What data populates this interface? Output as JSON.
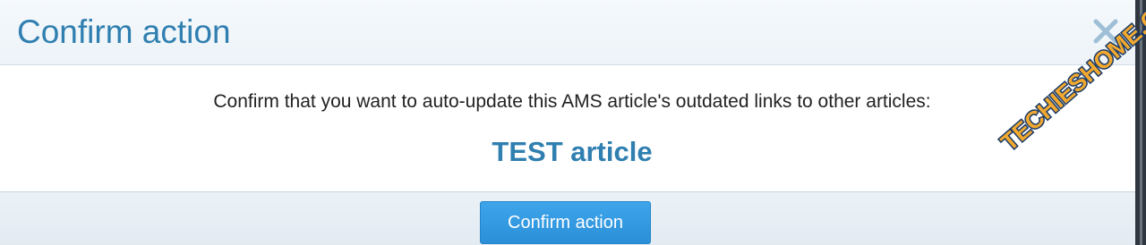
{
  "dialog": {
    "title": "Confirm action",
    "close_icon": "close-icon",
    "message": "Confirm that you want to auto-update this AMS article's outdated links to other articles:",
    "article_title": "TEST article",
    "confirm_label": "Confirm action"
  },
  "watermark": {
    "text": "TECHIESHOME.COM"
  },
  "colors": {
    "title": "#2f7fb0",
    "button": "#3399e0",
    "close_icon": "#9fbfd6"
  }
}
